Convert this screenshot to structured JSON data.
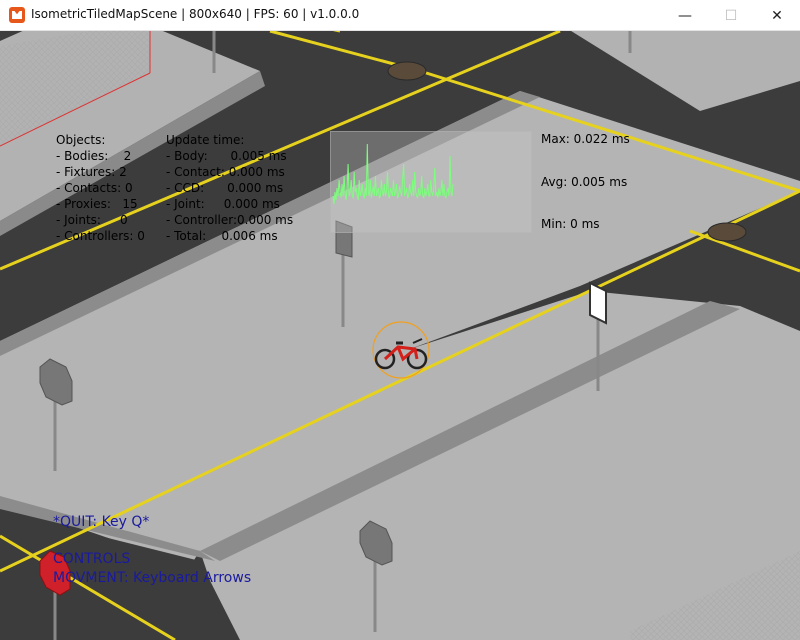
{
  "window": {
    "title": "IsometricTiledMapScene | 800x640 | FPS: 60 | v1.0.0.0",
    "icon": "monogame-icon",
    "minimize_glyph": "—",
    "maximize_glyph": "☐",
    "close_glyph": "✕"
  },
  "hud": {
    "objects": [
      "Objects:",
      "- Bodies:    2",
      "- Fixtures: 2",
      "- Contacts: 0",
      "- Proxies:   15",
      "- Joints:     0",
      "- Controllers: 0"
    ],
    "update": [
      "Update time:",
      "- Body:      0.005 ms",
      "- Contact: 0.000 ms",
      "- CCD:      0.000 ms",
      "- Joint:     0.000 ms",
      "- Controller:0.000 ms",
      "- Total:    0.006 ms"
    ],
    "max": "Max: 0.022 ms",
    "avg": "Avg: 0.005 ms",
    "min": "Min: 0 ms",
    "graph_values": [
      0.3,
      0.2,
      0.35,
      0.25,
      0.4,
      0.3,
      0.5,
      0.35,
      0.28,
      0.45,
      0.3,
      0.55,
      0.32,
      0.25,
      0.4,
      0.7,
      0.3,
      0.35,
      0.5,
      0.3,
      0.28,
      0.6,
      0.35,
      0.4,
      0.3,
      0.25,
      0.5,
      0.3,
      0.35,
      0.45,
      0.3,
      0.28,
      0.4,
      0.3,
      0.95,
      0.35,
      0.3,
      0.5,
      0.28,
      0.35,
      0.42,
      0.3,
      0.55,
      0.3,
      0.35,
      0.4,
      0.28,
      0.3,
      0.5,
      0.35,
      0.3,
      0.45,
      0.3,
      0.35,
      0.6,
      0.3,
      0.28,
      0.4,
      0.35,
      0.3,
      0.5,
      0.3,
      0.35,
      0.45,
      0.28,
      0.3,
      0.42,
      0.35,
      0.3,
      0.5,
      0.7,
      0.3,
      0.35,
      0.4,
      0.28,
      0.3,
      0.45,
      0.35,
      0.3,
      0.5,
      0.3,
      0.6,
      0.35,
      0.3,
      0.28,
      0.4,
      0.3,
      0.35,
      0.55,
      0.3,
      0.28,
      0.4,
      0.3,
      0.35,
      0.45,
      0.3,
      0.3,
      0.5,
      0.35,
      0.3,
      0.4,
      0.65,
      0.3,
      0.35,
      0.28,
      0.4,
      0.3,
      0.35,
      0.5,
      0.3,
      0.45,
      0.3,
      0.28,
      0.35,
      0.4,
      0.3,
      0.8,
      0.35,
      0.3,
      0.45
    ]
  },
  "controls": {
    "quit": "*QUIT: Key Q*",
    "heading": "CONTROLS",
    "movement": "MOVMENT: Keyboard Arrows"
  },
  "colors": {
    "road": "#3c3c3c",
    "sidewalk": "#b4b4b4",
    "lane_line": "#e6d21e",
    "hud_text": "#000000",
    "controls_text": "#1a1a9e",
    "graph_line": "#7cff7c",
    "bike_body": "#d4201a",
    "bike_outline": "#f0a020"
  }
}
